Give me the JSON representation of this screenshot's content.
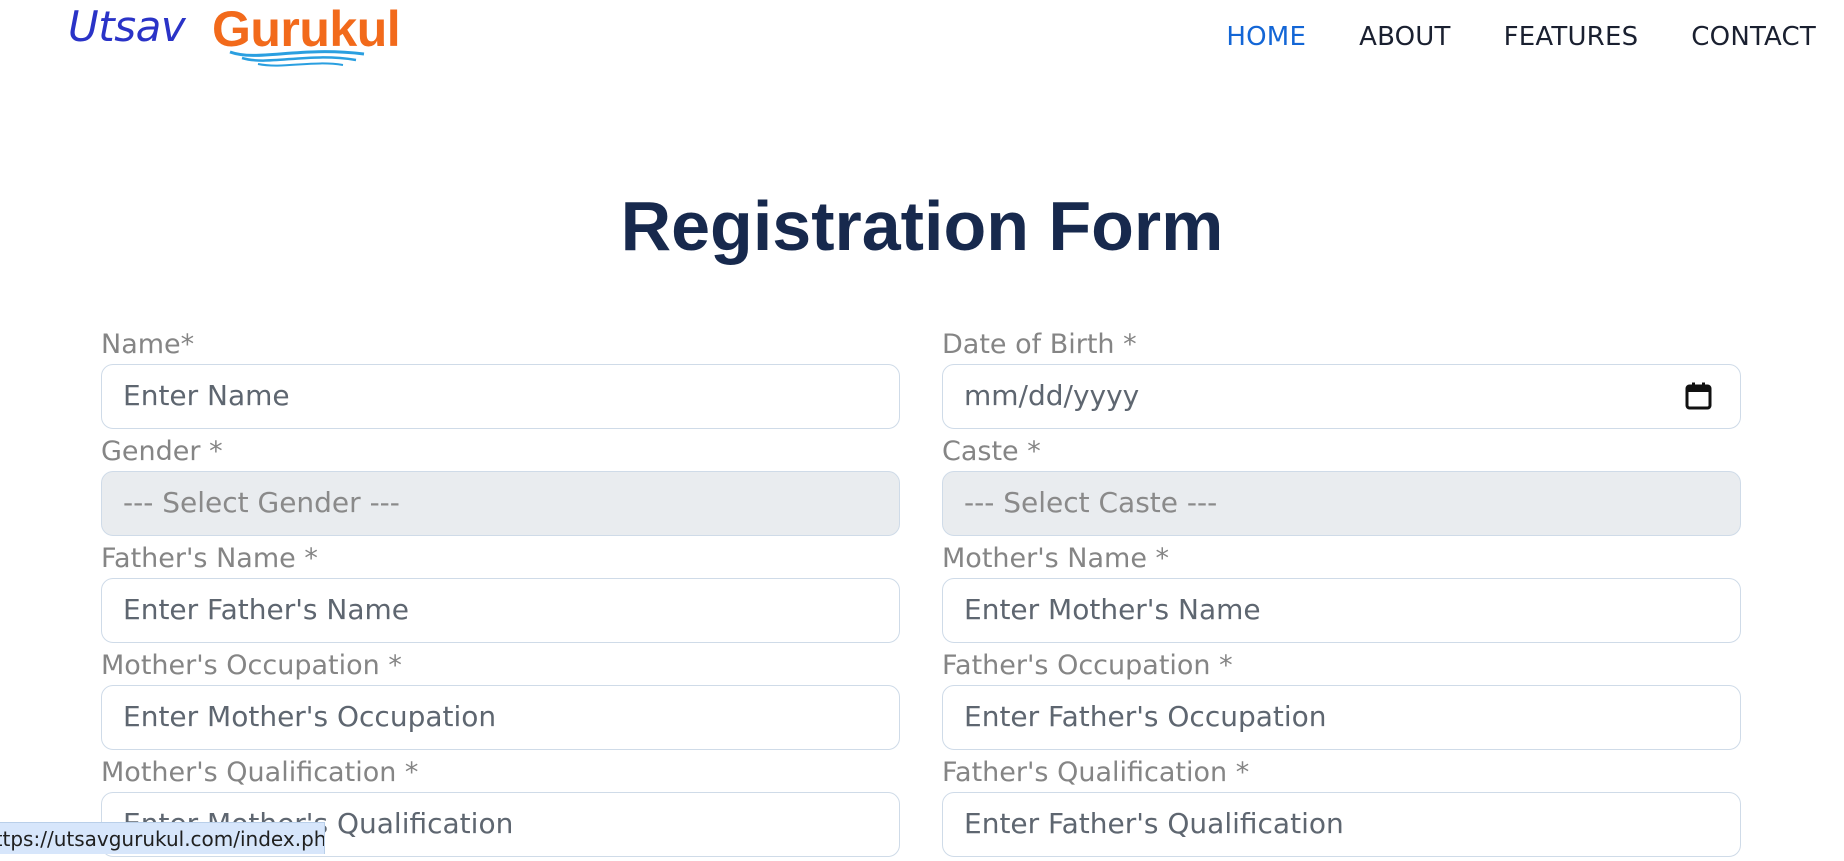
{
  "brand": {
    "name_part1": "Utsav",
    "name_part2": "Gurukul"
  },
  "nav": {
    "items": [
      {
        "label": "HOME",
        "active": true
      },
      {
        "label": "ABOUT",
        "active": false
      },
      {
        "label": "FEATURES",
        "active": false
      },
      {
        "label": "CONTACT",
        "active": false
      }
    ]
  },
  "page": {
    "title": "Registration Form"
  },
  "form": {
    "name": {
      "label": "Name*",
      "placeholder": "Enter Name"
    },
    "dob": {
      "label": "Date of Birth *",
      "placeholder": "mm/dd/yyyy"
    },
    "gender": {
      "label": "Gender *",
      "selected": "--- Select Gender ---"
    },
    "caste": {
      "label": "Caste *",
      "selected": "--- Select Caste ---"
    },
    "father_name": {
      "label": "Father's Name *",
      "placeholder": "Enter Father's Name"
    },
    "mother_name": {
      "label": "Mother's Name *",
      "placeholder": "Enter Mother's Name"
    },
    "mother_occupation": {
      "label": "Mother's Occupation *",
      "placeholder": "Enter Mother's Occupation"
    },
    "father_occupation": {
      "label": "Father's Occupation *",
      "placeholder": "Enter Father's Occupation"
    },
    "mother_qualification": {
      "label": "Mother's Qualification *",
      "placeholder": "Enter Mother's Qualification"
    },
    "father_qualification": {
      "label": "Father's Qualification *",
      "placeholder": "Enter Father's Qualification"
    }
  },
  "status_bar": {
    "url": "https://utsavgurukul.com/index.php"
  },
  "colors": {
    "brand_blue": "#2a33c7",
    "brand_orange": "#f26a1b",
    "nav_active": "#1366d6",
    "title": "#17294d"
  }
}
